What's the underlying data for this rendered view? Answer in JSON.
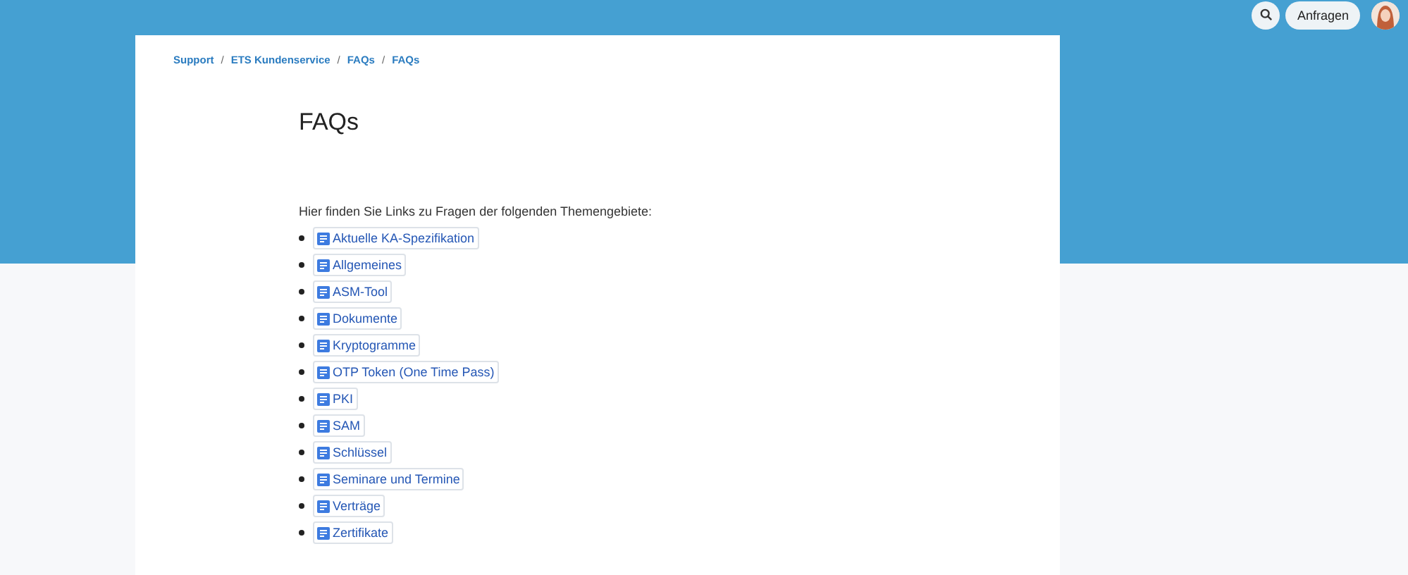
{
  "header": {
    "actions": [
      {
        "kind": "search"
      },
      {
        "kind": "button",
        "label": "Anfragen"
      },
      {
        "kind": "avatar"
      }
    ]
  },
  "breadcrumbs": [
    "Support",
    "ETS Kundenservice",
    "FAQs",
    "FAQs"
  ],
  "breadcrumb_separator": "/",
  "page": {
    "title": "FAQs",
    "intro": "Hier finden Sie Links zu Fragen der folgenden Themengebiete:",
    "links": [
      "Aktuelle KA-Spezifikation",
      "Allgemeines",
      "ASM-Tool",
      "Dokumente",
      "Kryptogramme",
      "OTP Token (One Time Pass)",
      "PKI",
      "SAM",
      "Schlüssel",
      "Seminare und Termine",
      "Verträge",
      "Zertifikate"
    ]
  }
}
